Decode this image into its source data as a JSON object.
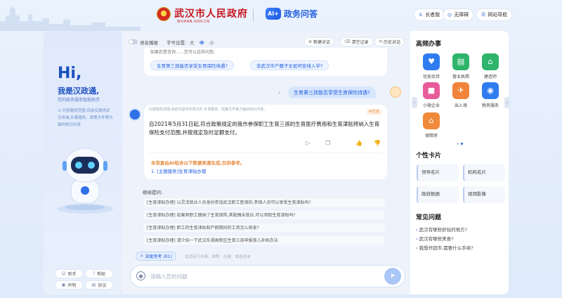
{
  "header": {
    "gov_title": "武汉市人民政府",
    "gov_url": "WUHAN.GOV.CN",
    "ai_badge": "AI+",
    "ai_title": "政务问答",
    "elder_label": "长者版",
    "barrier_free_label": "无障碍",
    "site_nav_label": "网站导航"
  },
  "left": {
    "hi": "Hi,",
    "intro": "我是汉政通,",
    "intro_sub": "您的政务服务智能助手",
    "notice": "① 问答服务范围:目前仅提供武汉市域,办事服务、政策文件等方面的知识问答",
    "buttons": [
      {
        "label": "新手",
        "icon": "smile-icon"
      },
      {
        "label": "帮助",
        "icon": "help-icon"
      },
      {
        "label": "声明",
        "icon": "statement-icon"
      },
      {
        "label": "协议",
        "icon": "agreement-icon"
      }
    ]
  },
  "toolbar": {
    "voice_label": "语音播报",
    "font_size_label": "字号设置:",
    "sizes": [
      "大",
      "中",
      "小"
    ],
    "new_chat": "新建对话",
    "clear": "清空记录",
    "history": "历史对话"
  },
  "chat": {
    "prev_text": "如果您是咨询……您可以这样问我:",
    "prev_chips": [
      "生育第三孩能否享受生育保险待遇?",
      "非武汉市户籍子女如何安排入学?"
    ],
    "user_question": "生育第三孩能否享受生育保险待遇?",
    "answer_scope": "问答服务范围:目前仅提供市政文件,办事服务、政策文件等方面的知识问答。",
    "ai_generated": "AI生成",
    "answer_text": "自2021年5月31日起,符合政策规定的我市参保职工生育三孩的生育医疗费用和生育津贴将纳入生育保险支付范围,并按规定及时足额支付。",
    "ref_title": "本答复由AI结合以下数据来源生成,仅供参考。",
    "ref_link": "1. [主题服务]生育津贴办理",
    "follow_title": "继续提问:",
    "follow_up": [
      "[生育津贴办理] 以灵活就业人员身份参加武汉职工医保的,参保人员可以享受生育津贴吗?",
      "[生育津贴办理] 如果男职工缴纳了生育保险,其配偶未就业,可以领取生育津贴吗?",
      "[生育津贴办理] 职工的生育津贴和产假期间的工资怎么核发?",
      "[生育津贴办理] 请介绍一下武汉东湖高新区生育三孩申报育儿补贴办法"
    ]
  },
  "input": {
    "deep_think": "深度思考 (R1)",
    "deep_hint": "仅适用于市情、政策、办事、旅游咨询",
    "placeholder": "请输入您的问题"
  },
  "right": {
    "hot_title": "高频办事",
    "services": [
      {
        "label": "优抚优待",
        "color": "#2f7cf0",
        "icon": "heart-icon",
        "glyph": "♥"
      },
      {
        "label": "营业执照",
        "color": "#2fb56b",
        "icon": "license-icon",
        "glyph": "▤"
      },
      {
        "label": "建造师",
        "color": "#2fb56b",
        "icon": "builder-icon",
        "glyph": "⌂"
      },
      {
        "label": "小微企业",
        "color": "#e85b9a",
        "icon": "enterprise-icon",
        "glyph": "■"
      },
      {
        "label": "出入境",
        "color": "#f0843a",
        "icon": "passport-icon",
        "glyph": "✈"
      },
      {
        "label": "税务服务",
        "color": "#2f7cf0",
        "icon": "tax-icon",
        "glyph": "◉"
      },
      {
        "label": "保障房",
        "color": "#f08a3a",
        "icon": "housing-icon",
        "glyph": "⌂"
      }
    ],
    "cards_title": "个性卡片",
    "cards": [
      "领导名片",
      "机构名片",
      "政府数据",
      "视频影像"
    ],
    "faq_title": "常见问题",
    "faqs": [
      "武汉有哪些好玩的地方?",
      "武汉有哪些美食?",
      "我想开超市,需要什么手续?"
    ]
  }
}
